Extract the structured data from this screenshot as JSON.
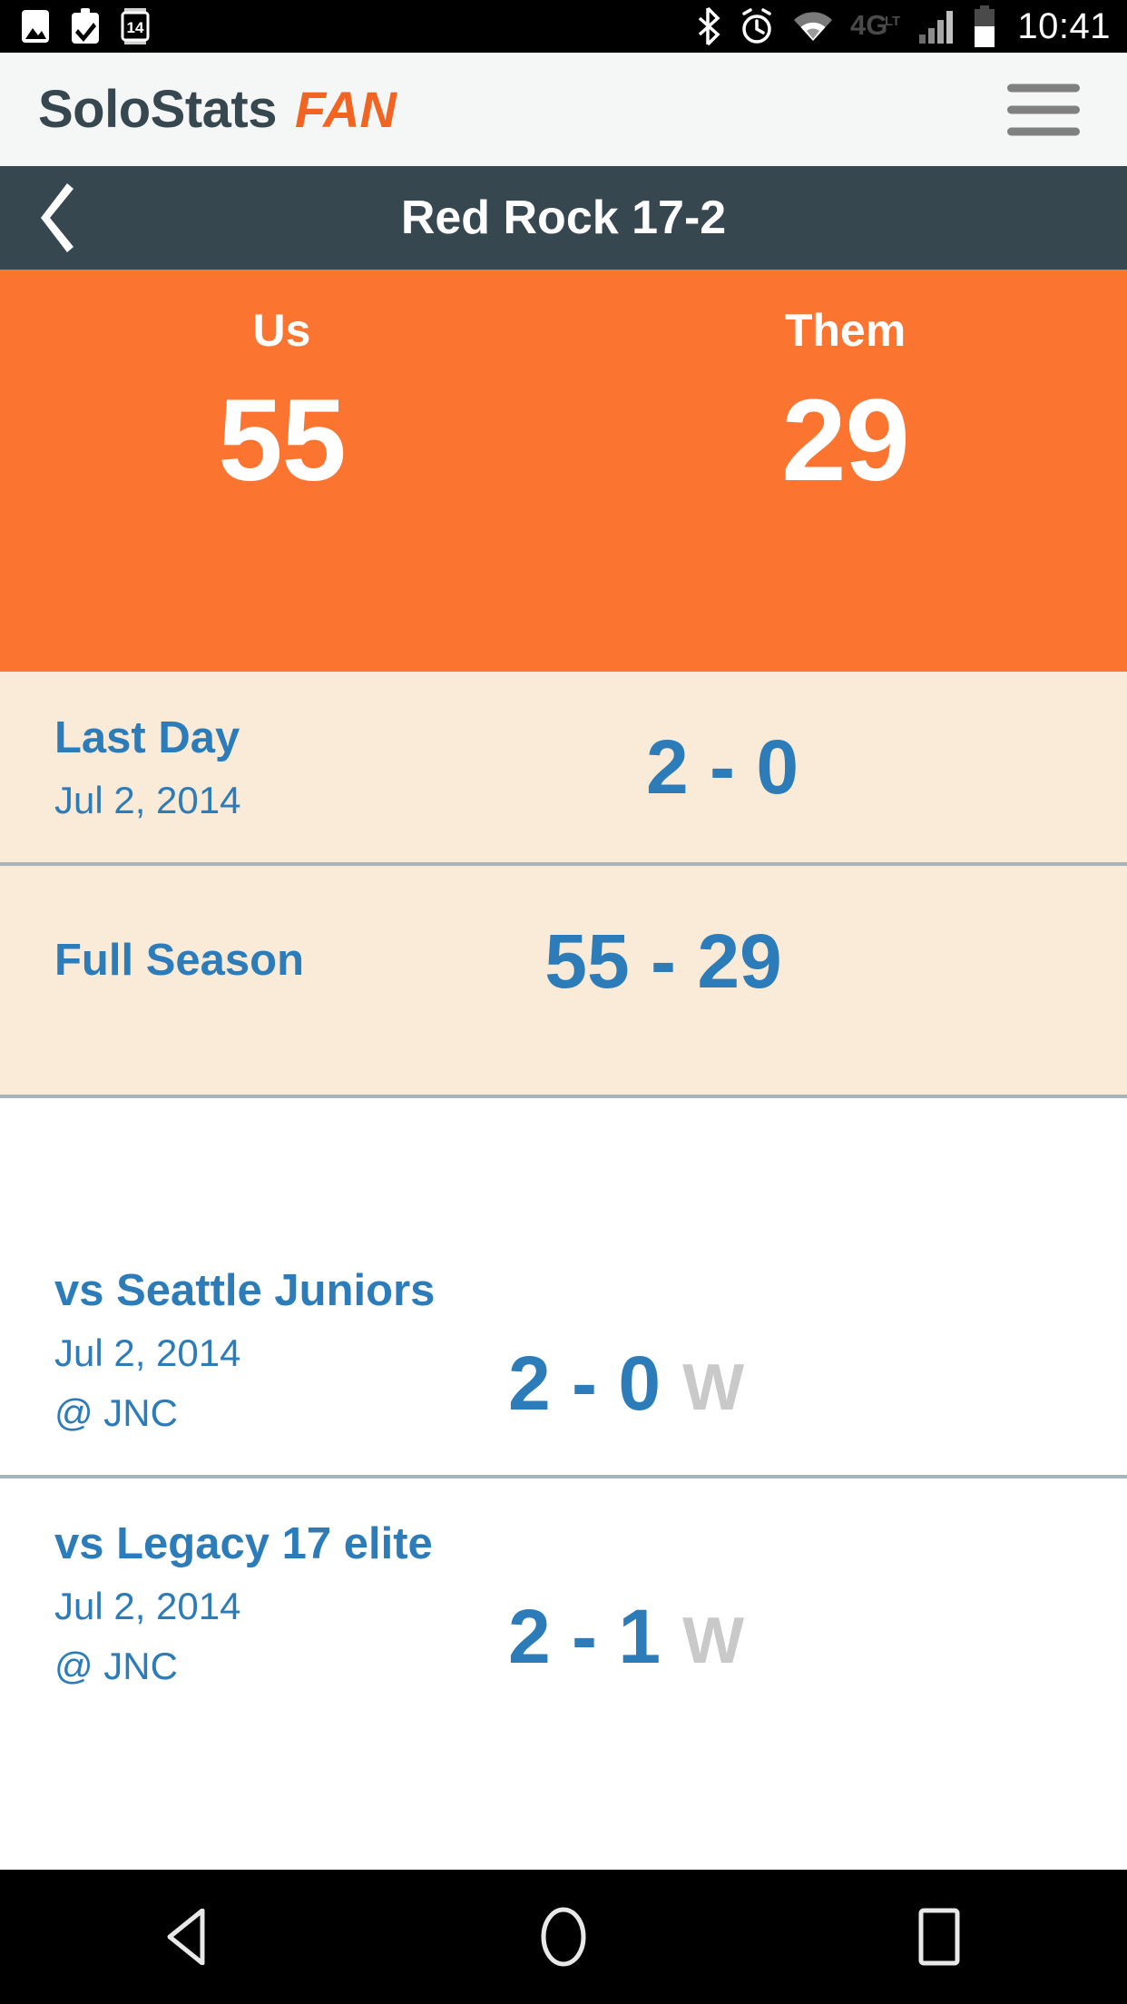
{
  "status_bar": {
    "time": "10:41",
    "left_icons": [
      "image-icon",
      "clipboard-check-icon",
      "calendar-14-icon"
    ],
    "right_icons": [
      "bluetooth-icon",
      "alarm-clock-icon",
      "wifi-icon",
      "4glte-icon",
      "signal-bars-icon",
      "battery-icon"
    ],
    "network_label": "4G",
    "network_sublabel": "LTE",
    "battery_level_percent": 55
  },
  "app_bar": {
    "brand_main": "SoloStats",
    "brand_sub": "FAN",
    "menu_icon": "hamburger-icon"
  },
  "title_bar": {
    "back_icon": "chevron-left-icon",
    "title": "Red Rock 17-2"
  },
  "score_banner": {
    "us_label": "Us",
    "us_score": "55",
    "them_label": "Them",
    "them_score": "29"
  },
  "summary_rows": [
    {
      "title": "Last Day",
      "date": "Jul 2, 2014",
      "score": "2 - 0"
    },
    {
      "title": "Full Season",
      "date": "",
      "score": "55 - 29"
    }
  ],
  "games": [
    {
      "opponent": "vs Seattle Juniors",
      "date": "Jul 2, 2014",
      "location": "@ JNC",
      "score": "2 - 0",
      "result": "W"
    },
    {
      "opponent": "vs Legacy 17 elite",
      "date": "Jul 2, 2014",
      "location": "@ JNC",
      "score": "2 - 1",
      "result": "W"
    }
  ],
  "nav_bar": {
    "back_icon": "triangle-back-icon",
    "home_icon": "circle-home-icon",
    "recents_icon": "square-recents-icon"
  },
  "colors": {
    "orange": "#fb7430",
    "brand_orange": "#f26422",
    "dark_slate": "#37474f",
    "blue": "#2c7cba",
    "cream": "#faebd9",
    "gray_divider": "#a8b4bc",
    "result_gray": "#c9c9c9",
    "appbar_bg": "#f5f6f6"
  }
}
